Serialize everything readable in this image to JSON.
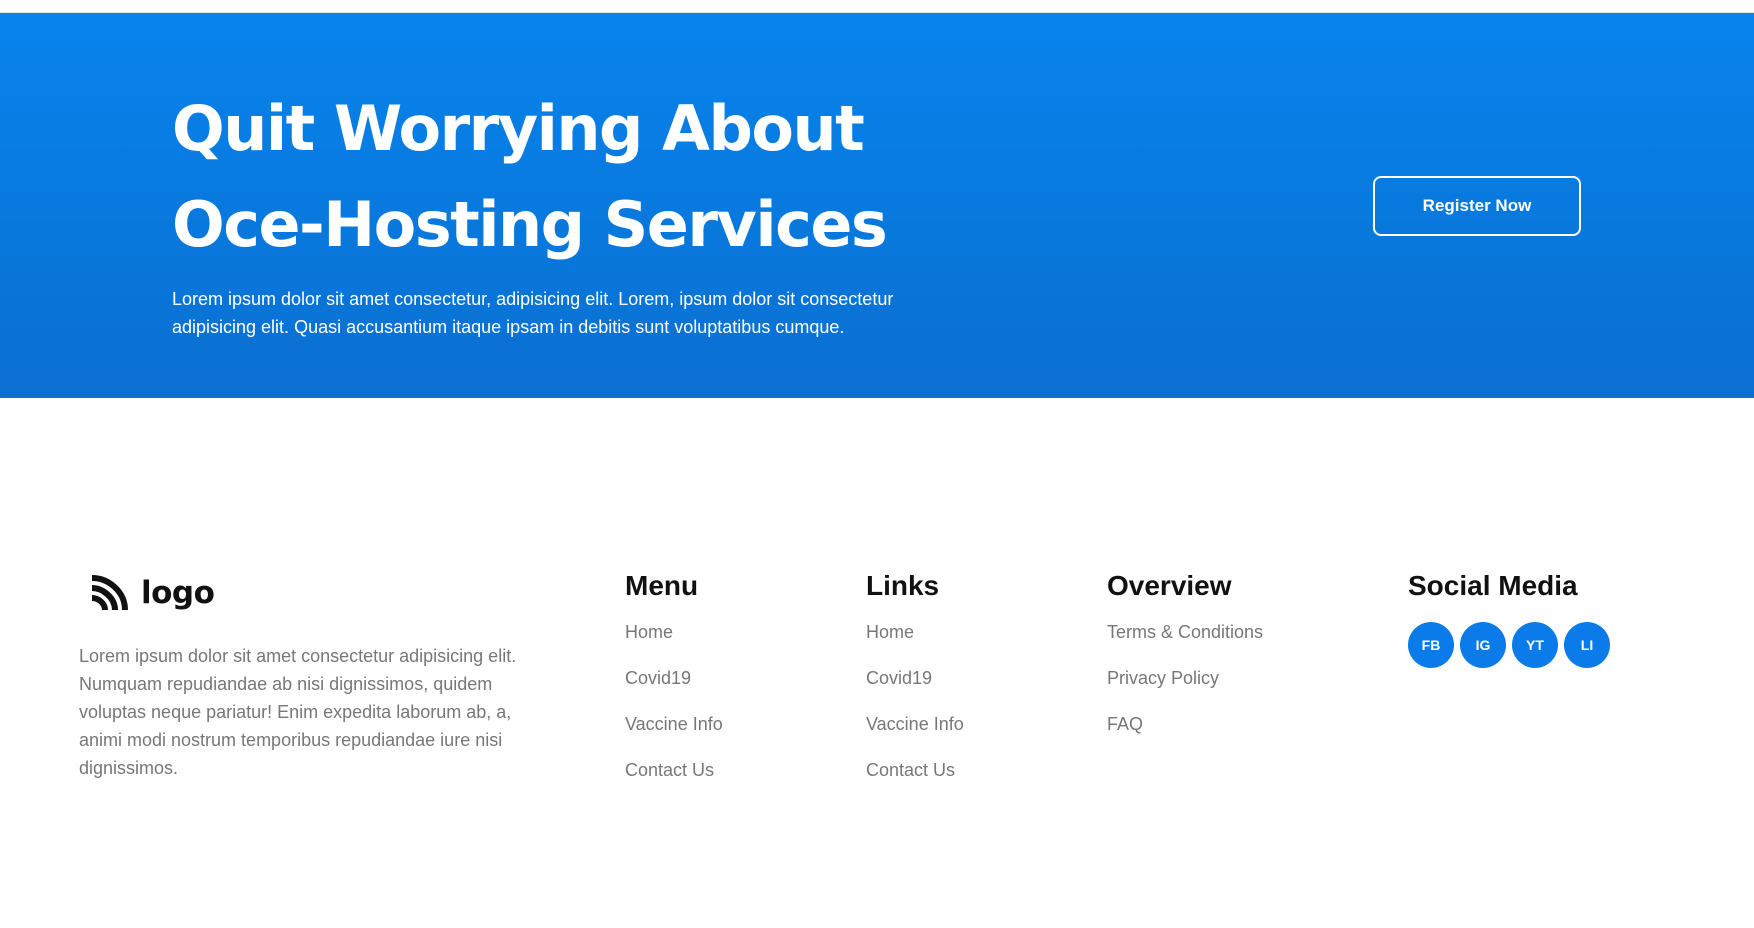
{
  "hero": {
    "title_line1": "Quit Worrying About",
    "title_line2": "Oce-Hosting Services",
    "description": "Lorem ipsum dolor sit amet consectetur, adipisicing elit. Lorem, ipsum dolor sit consectetur adipisicing elit. Quasi accusantium itaque ipsam in debitis sunt voluptatibus cumque.",
    "cta_label": "Register Now",
    "background_color": "#0784ec"
  },
  "footer": {
    "brand": {
      "logo_text": "logo",
      "logo_icon": "rss-like-logo-icon",
      "description": "Lorem ipsum dolor sit amet consectetur adipisicing elit. Numquam repudiandae ab nisi dignissimos, quidem voluptas neque pariatur! Enim expedita laborum ab, a, animi modi nostrum temporibus repudiandae iure nisi dignissimos."
    },
    "menu": {
      "title": "Menu",
      "items": [
        "Home",
        "Covid19",
        "Vaccine Info",
        "Contact Us"
      ]
    },
    "links": {
      "title": "Links",
      "items": [
        "Home",
        "Covid19",
        "Vaccine Info",
        "Contact Us"
      ]
    },
    "overview": {
      "title": "Overview",
      "items": [
        "Terms & Conditions",
        "Privacy Policy",
        "FAQ"
      ]
    },
    "social": {
      "title": "Social Media",
      "items": [
        "FB",
        "IG",
        "YT",
        "LI"
      ],
      "button_color": "#0a7be8"
    }
  }
}
